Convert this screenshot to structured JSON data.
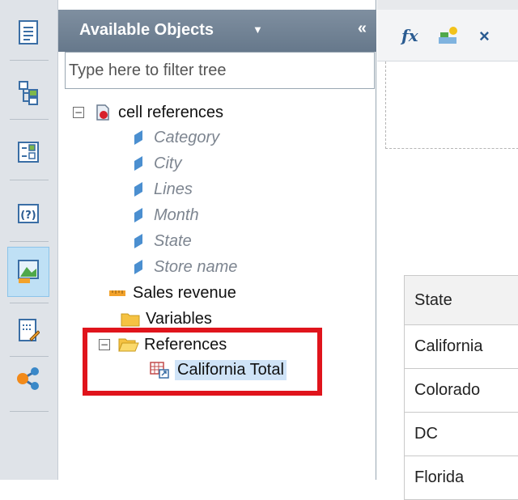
{
  "toolbar_vertical": {
    "items": [
      {
        "icon": "document-icon"
      },
      {
        "icon": "hierarchy-icon"
      },
      {
        "icon": "checklist-icon"
      },
      {
        "icon": "help-icon"
      },
      {
        "icon": "chart-icon",
        "active": true
      },
      {
        "icon": "edit-document-icon"
      },
      {
        "icon": "share-icon"
      }
    ]
  },
  "panel": {
    "title": "Available Objects",
    "collapse_label": "«",
    "filter_placeholder": "Type here to filter tree",
    "tree": {
      "root": "cell references",
      "dimensions": [
        "Category",
        "City",
        "Lines",
        "Month",
        "State",
        "Store name"
      ],
      "measure": "Sales revenue",
      "variables": "Variables",
      "references": "References",
      "reference_item": "California Total"
    }
  },
  "formula_bar": {
    "fx_label": "fx",
    "cancel_label": "×"
  },
  "table": {
    "header": "State",
    "rows": [
      "California",
      "Colorado",
      "DC",
      "Florida"
    ]
  },
  "colors": {
    "highlight": "#e0141c",
    "panel_header": "#708296",
    "selection": "#cfe3f7"
  }
}
